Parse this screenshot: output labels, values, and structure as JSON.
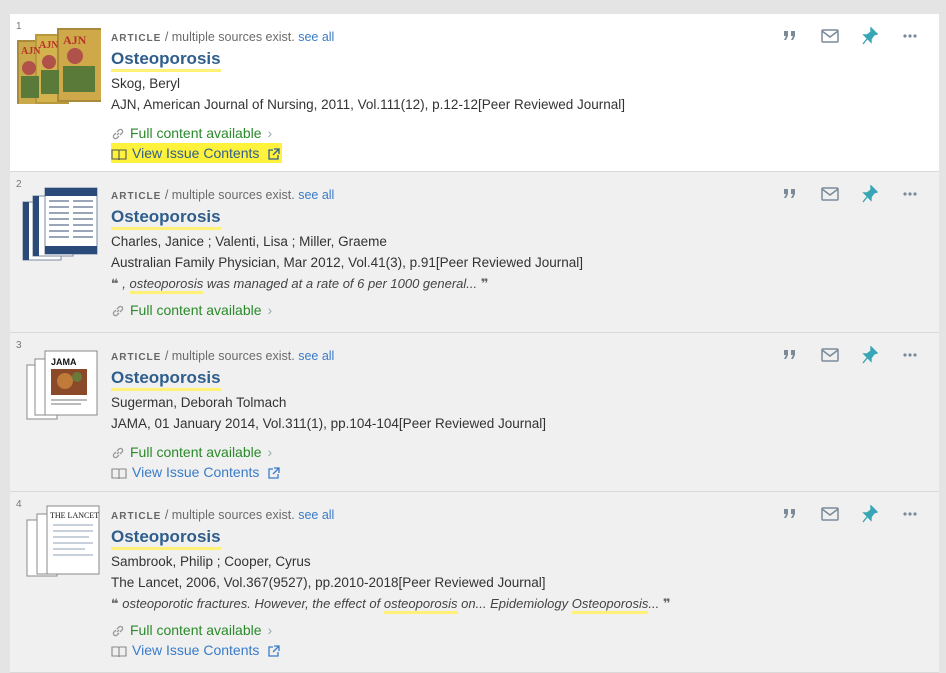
{
  "results": [
    {
      "number": "1",
      "type": "ARTICLE",
      "multi_sources": " / multiple sources exist. ",
      "see_all": "see all",
      "title": "Osteoporosis",
      "authors": "Skog, Beryl",
      "source": "AJN, American Journal of Nursing, 2011, Vol.111(12), p.12-12[Peer Reviewed Journal]",
      "availability": "Full content available",
      "issue_link": "View Issue Contents",
      "thumb_text": "AJN"
    },
    {
      "number": "2",
      "type": "ARTICLE",
      "multi_sources": " / multiple sources exist. ",
      "see_all": "see all",
      "title": "Osteoporosis",
      "authors": "Charles, Janice ; Valenti, Lisa ; Miller, Graeme",
      "source": "Australian Family Physician, Mar 2012, Vol.41(3), p.91[Peer Reviewed Journal]",
      "snippet_pre": ", ",
      "snippet_hl": "osteoporosis",
      "snippet_post": " was managed at a rate of 6 per 1000 general...",
      "availability": "Full content available"
    },
    {
      "number": "3",
      "type": "ARTICLE",
      "multi_sources": " / multiple sources exist. ",
      "see_all": "see all",
      "title": "Osteoporosis",
      "authors": "Sugerman, Deborah Tolmach",
      "source": "JAMA, 01 January 2014, Vol.311(1), pp.104-104[Peer Reviewed Journal]",
      "availability": "Full content available",
      "issue_link": "View Issue Contents",
      "thumb_text": "JAMA"
    },
    {
      "number": "4",
      "type": "ARTICLE",
      "multi_sources": " / multiple sources exist. ",
      "see_all": "see all",
      "title": "Osteoporosis",
      "authors": "Sambrook, Philip ; Cooper, Cyrus",
      "source": "The Lancet, 2006, Vol.367(9527), pp.2010-2018[Peer Reviewed Journal]",
      "snippet_a": "osteoporotic fractures. However, the effect of ",
      "snippet_hl1": "osteoporosis",
      "snippet_b": " on... Epidemiology ",
      "snippet_hl2": "Osteoporosis",
      "snippet_c": "...",
      "availability": "Full content available",
      "issue_link": "View Issue Contents",
      "thumb_text": "THE LANCET"
    }
  ],
  "icons": {
    "cite": "quote-icon",
    "email": "mail-icon",
    "pin": "pin-icon",
    "more": "more-icon",
    "link": "link-icon",
    "book": "book-icon",
    "external": "external-link-icon"
  },
  "colors": {
    "title": "#2f5e8d",
    "available": "#2a8a2a",
    "link": "#3a7bc8",
    "pin": "#37a6b5",
    "highlight": "#fff176"
  }
}
